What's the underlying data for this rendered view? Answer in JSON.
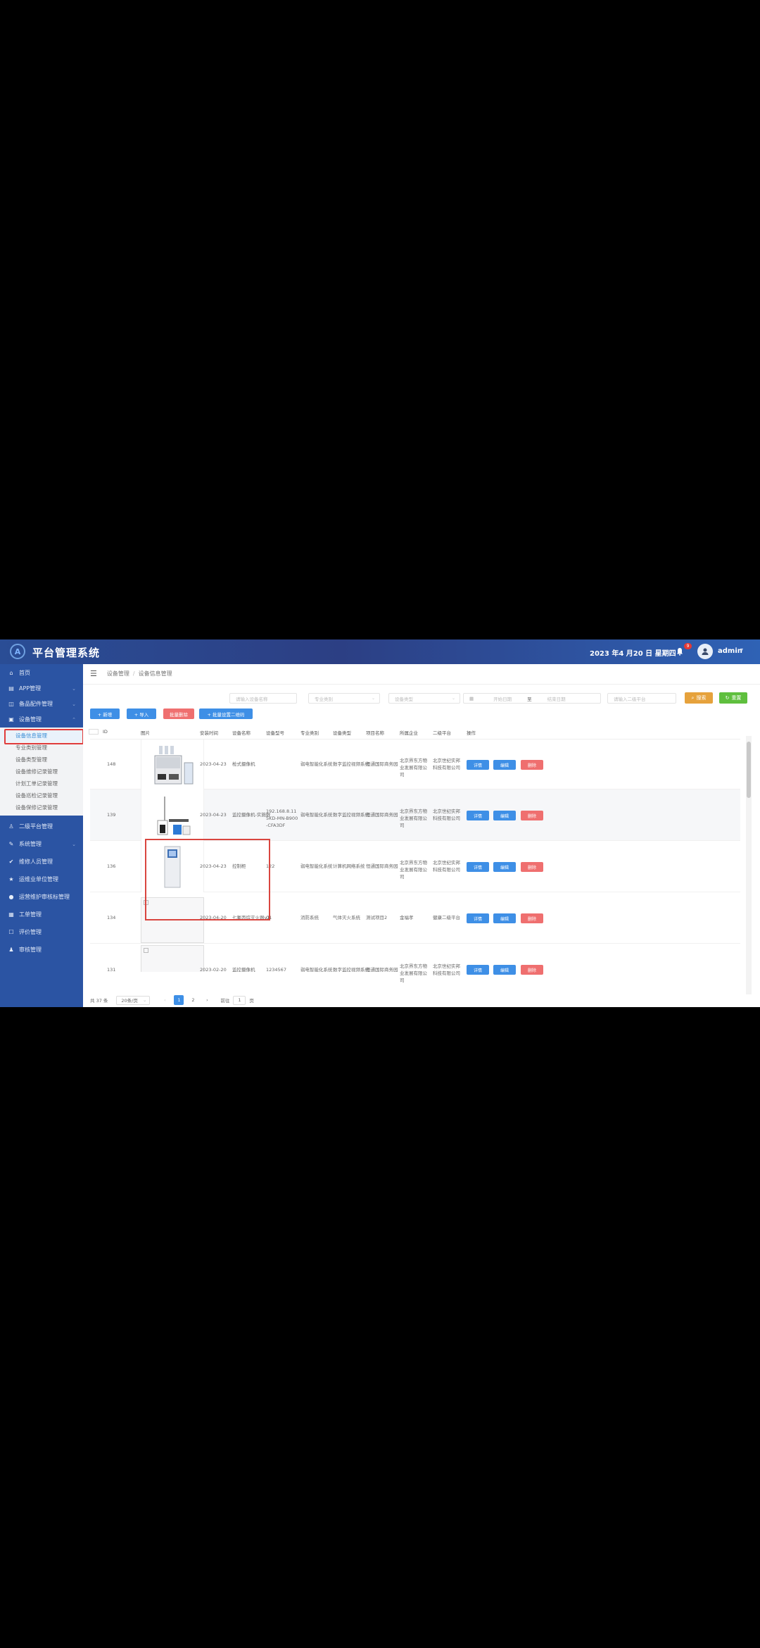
{
  "header": {
    "app_title": "平台管理系统",
    "date": "2023 年4 月20 日  星期四",
    "notification_count": "9",
    "username": "admin"
  },
  "sidebar": {
    "items": [
      {
        "label": "首页",
        "icon": "home-icon"
      },
      {
        "label": "APP管理",
        "icon": "app-icon",
        "expandable": true
      },
      {
        "label": "备品配件管理",
        "icon": "parts-icon",
        "expandable": true
      },
      {
        "label": "设备管理",
        "icon": "device-icon",
        "expandable": true,
        "expanded": true
      },
      {
        "label": "二级平台管理",
        "icon": "user-icon"
      },
      {
        "label": "系统管理",
        "icon": "wrench-icon",
        "expandable": true
      },
      {
        "label": "维修人员管理",
        "icon": "staff-icon"
      },
      {
        "label": "运维业单位管理",
        "icon": "star-icon"
      },
      {
        "label": "运营维护审核标管理",
        "icon": "info-icon"
      },
      {
        "label": "工单管理",
        "icon": "ticket-icon"
      },
      {
        "label": "评价管理",
        "icon": "review-icon"
      },
      {
        "label": "审核管理",
        "icon": "person-icon"
      }
    ],
    "submenu": [
      {
        "label": "设备信息管理",
        "active": true
      },
      {
        "label": "专业类别管理"
      },
      {
        "label": "设备类型管理"
      },
      {
        "label": "设备维修记录管理"
      },
      {
        "label": "计划工单记录管理"
      },
      {
        "label": "设备巡检记录管理"
      },
      {
        "label": "设备保修记录管理"
      }
    ]
  },
  "breadcrumb": [
    "设备管理",
    "设备信息管理"
  ],
  "filters": {
    "name_placeholder": "请输入设备名称",
    "category_placeholder": "专业类别",
    "type_placeholder": "设备类型",
    "start_date_placeholder": "开始日期",
    "date_separator": "至",
    "end_date_placeholder": "结束日期",
    "platform_placeholder": "请输入二级平台",
    "search_label": "搜索",
    "reset_label": "重置"
  },
  "toolbar": {
    "add_label": "+ 新增",
    "import_label": "+ 导入",
    "batch_delete_label": "批量删除",
    "qrcode_label": "+ 批量设置二维码"
  },
  "table": {
    "columns": [
      "ID",
      "图片",
      "安装时间",
      "设备名称",
      "设备型号",
      "专业类别",
      "设备类型",
      "项目名称",
      "所属企业",
      "二级平台",
      "操作"
    ],
    "rows": [
      {
        "id": "148",
        "image": "device-photo",
        "install_date": "2023-04-23",
        "name": "枪式摄像机",
        "model": "",
        "category": "弱电智能化系统",
        "type": "数字监控视频系统",
        "project": "恒通国际商务园",
        "company": "北京界东方物业发展有限公司",
        "platform": "北京世纪实邦科技有限公司"
      },
      {
        "id": "139",
        "image": "device-photo",
        "install_date": "2023-04-23",
        "name": "监控摄像机-实施数",
        "model": "192.168.8.115KD-MN-B900-CFA3DF",
        "category": "弱电智能化系统",
        "type": "数字监控视频系统",
        "project": "恒通国际商务园",
        "company": "北京界东方物业发展有限公司",
        "platform": "北京世纪实邦科技有限公司"
      },
      {
        "id": "136",
        "image": "device-photo",
        "install_date": "2023-04-23",
        "name": "控制柜",
        "model": "122",
        "category": "弱电智能化系统",
        "type": "计算机网络系统",
        "project": "恒通国际商务园",
        "company": "北京界东方物业发展有限公司",
        "platform": "北京世纪实邦科技有限公司"
      },
      {
        "id": "134",
        "image": "broken",
        "install_date": "2023-04-20",
        "name": "七氟丙烷灭火器v1",
        "model": "01",
        "category": "消防系统",
        "type": "气体灭火系统",
        "project": "测试项目2",
        "company": "金福孝",
        "platform": "健康二级平台"
      },
      {
        "id": "131",
        "image": "broken",
        "install_date": "2023-02-20",
        "name": "监控摄像机",
        "model": "1234567",
        "category": "弱电智能化系统",
        "type": "数字监控视频系统",
        "project": "恒通国际商务园",
        "company": "北京界东方物业发展有限公司",
        "platform": "北京世纪实邦科技有限公司"
      }
    ],
    "actions": {
      "detail": "详情",
      "edit": "编辑",
      "delete": "删除"
    }
  },
  "pagination": {
    "total": "共 37 条",
    "page_size": "20条/页",
    "pages": [
      "1",
      "2"
    ],
    "current_page": "1",
    "goto_prefix": "前往",
    "goto_value": "1",
    "goto_suffix": "页"
  },
  "colors": {
    "header_bg": "#2c3f84",
    "sidebar_bg": "#2b54a3",
    "primary": "#3e8fe6",
    "danger": "#ef6f6f",
    "warning": "#e6a23c",
    "success": "#5fbf3e",
    "highlight": "#d9453f"
  }
}
